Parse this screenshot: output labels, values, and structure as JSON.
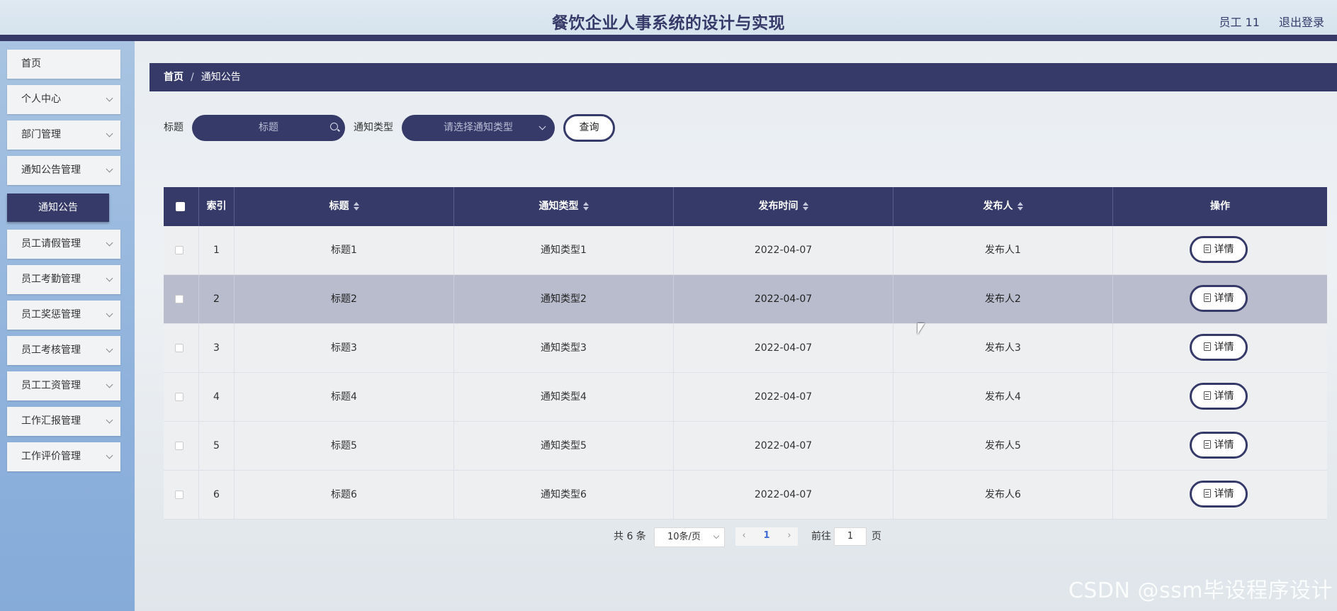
{
  "header": {
    "title": "餐饮企业人事系统的设计与实现",
    "user": "员工 11",
    "logout": "退出登录"
  },
  "sidebar": {
    "items": [
      {
        "label": "首页"
      },
      {
        "label": "个人中心"
      },
      {
        "label": "部门管理"
      },
      {
        "label": "通知公告管理"
      },
      {
        "label": "员工请假管理"
      },
      {
        "label": "员工考勤管理"
      },
      {
        "label": "员工奖惩管理"
      },
      {
        "label": "员工考核管理"
      },
      {
        "label": "员工工资管理"
      },
      {
        "label": "工作汇报管理"
      },
      {
        "label": "工作评价管理"
      }
    ],
    "submenu_active": "通知公告"
  },
  "breadcrumb": {
    "home": "首页",
    "separator": "/",
    "current": "通知公告"
  },
  "search": {
    "title_label": "标题",
    "title_placeholder": "标题",
    "type_label": "通知类型",
    "type_placeholder": "请选择通知类型",
    "query_button": "查询"
  },
  "table": {
    "columns": [
      "索引",
      "标题",
      "通知类型",
      "发布时间",
      "发布人",
      "操作"
    ],
    "rows": [
      {
        "index": "1",
        "title": "标题1",
        "type": "通知类型1",
        "time": "2022-04-07",
        "publisher": "发布人1",
        "action": "详情"
      },
      {
        "index": "2",
        "title": "标题2",
        "type": "通知类型2",
        "time": "2022-04-07",
        "publisher": "发布人2",
        "action": "详情"
      },
      {
        "index": "3",
        "title": "标题3",
        "type": "通知类型3",
        "time": "2022-04-07",
        "publisher": "发布人3",
        "action": "详情"
      },
      {
        "index": "4",
        "title": "标题4",
        "type": "通知类型4",
        "time": "2022-04-07",
        "publisher": "发布人4",
        "action": "详情"
      },
      {
        "index": "5",
        "title": "标题5",
        "type": "通知类型5",
        "time": "2022-04-07",
        "publisher": "发布人5",
        "action": "详情"
      },
      {
        "index": "6",
        "title": "标题6",
        "type": "通知类型6",
        "time": "2022-04-07",
        "publisher": "发布人6",
        "action": "详情"
      }
    ]
  },
  "pagination": {
    "total": "共 6 条",
    "page_size": "10条/页",
    "prev": "‹",
    "current": "1",
    "next": "›",
    "goto_label": "前往",
    "goto_value": "1",
    "page_suffix": "页"
  },
  "watermark": "CSDN @ssm毕设程序设计",
  "colors": {
    "primary": "#353a68",
    "sidebar": "#8fb2dc",
    "highlight_row": "#b9bccd"
  }
}
